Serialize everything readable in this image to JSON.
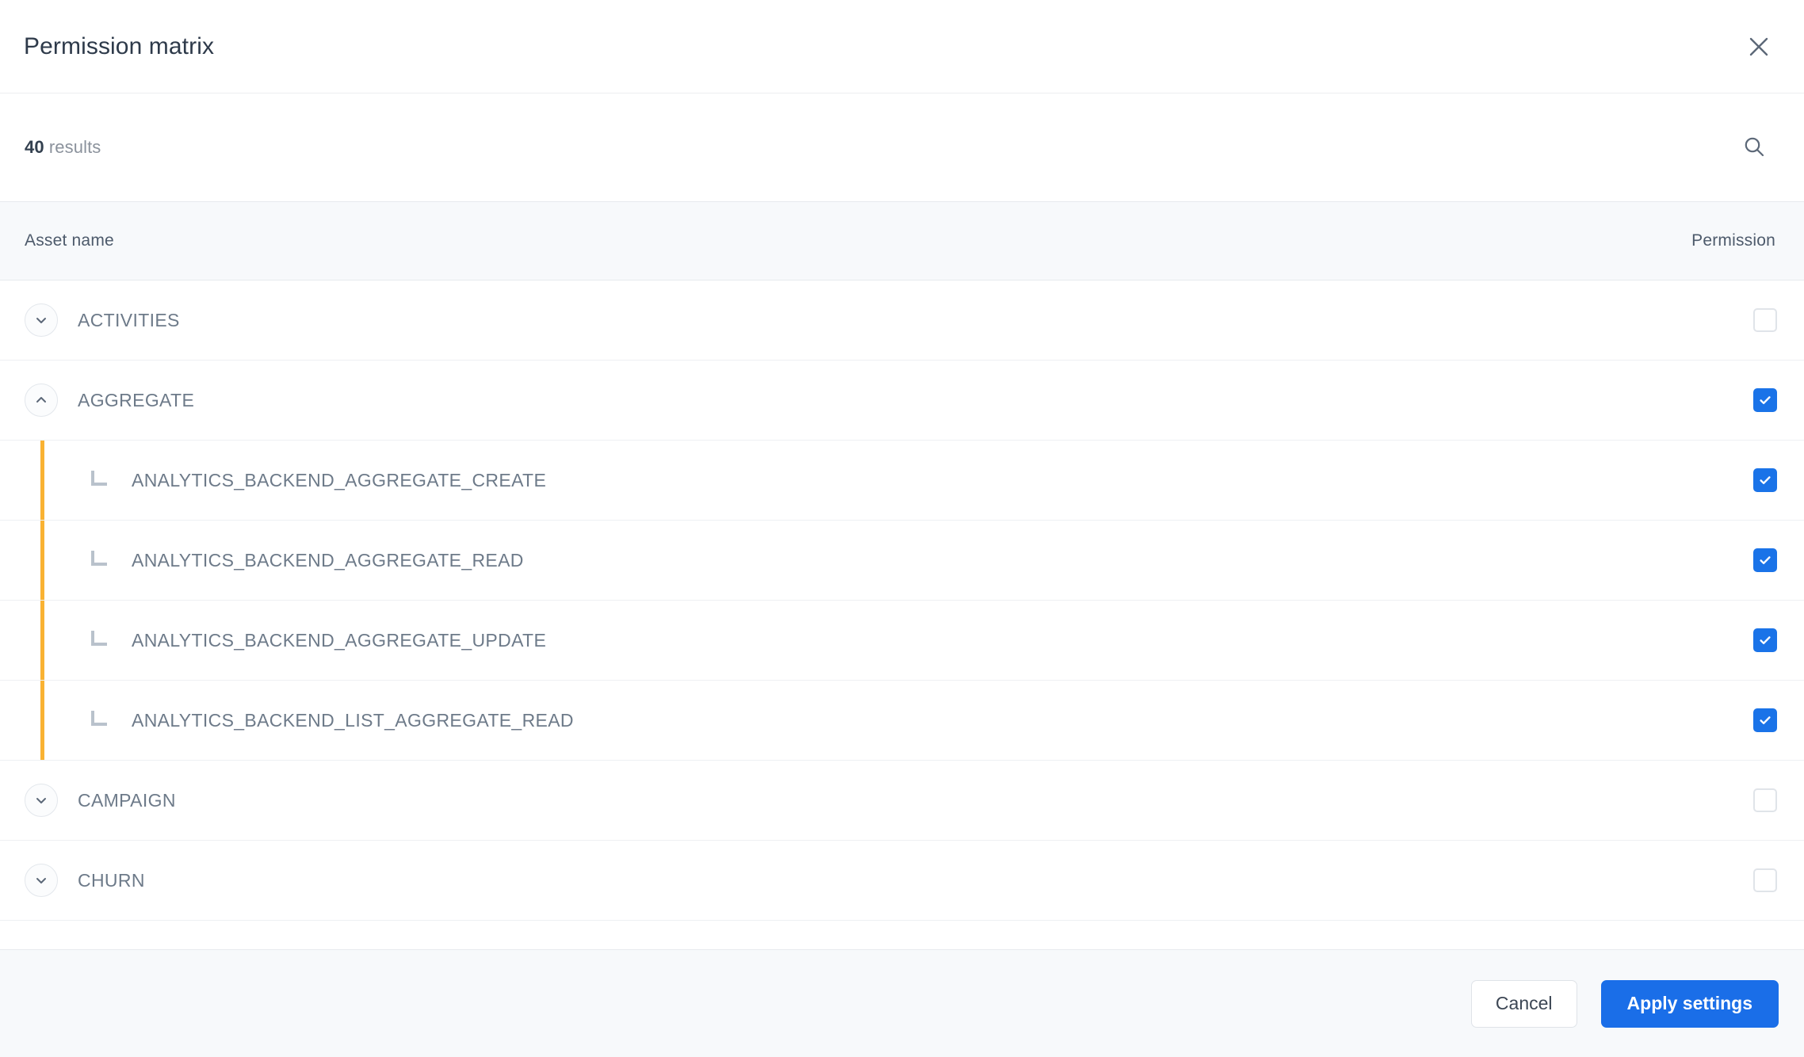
{
  "modal": {
    "title": "Permission matrix",
    "close_icon": "close-icon"
  },
  "toolbar": {
    "results_count": "40",
    "results_label": " results",
    "search_icon": "search-icon"
  },
  "table": {
    "columns": {
      "asset_name": "Asset name",
      "permission": "Permission"
    },
    "rows": [
      {
        "label": "ACTIVITIES",
        "type": "group",
        "expanded": false,
        "chevron": "chevron-down-icon",
        "checked": false
      },
      {
        "label": "AGGREGATE",
        "type": "group",
        "expanded": true,
        "chevron": "chevron-up-icon",
        "checked": true
      },
      {
        "label": "ANALYTICS_BACKEND_AGGREGATE_CREATE",
        "type": "child",
        "connector": "tree-branch-icon",
        "checked": true
      },
      {
        "label": "ANALYTICS_BACKEND_AGGREGATE_READ",
        "type": "child",
        "connector": "tree-branch-icon",
        "checked": true
      },
      {
        "label": "ANALYTICS_BACKEND_AGGREGATE_UPDATE",
        "type": "child",
        "connector": "tree-branch-icon",
        "checked": true
      },
      {
        "label": "ANALYTICS_BACKEND_LIST_AGGREGATE_READ",
        "type": "child",
        "connector": "tree-branch-icon",
        "checked": true
      },
      {
        "label": "CAMPAIGN",
        "type": "group",
        "expanded": false,
        "chevron": "chevron-down-icon",
        "checked": false
      },
      {
        "label": "CHURN",
        "type": "group",
        "expanded": false,
        "chevron": "chevron-down-icon",
        "checked": false
      }
    ]
  },
  "footer": {
    "cancel_label": "Cancel",
    "apply_label": "Apply settings"
  },
  "colors": {
    "accent_blue": "#1a73e8",
    "primary_button": "#1a6ee8",
    "group_guide_orange": "#f9b233",
    "header_band": "#f7f9fb",
    "text_slate": "#6d7a89",
    "title_text": "#2e3a4a"
  }
}
